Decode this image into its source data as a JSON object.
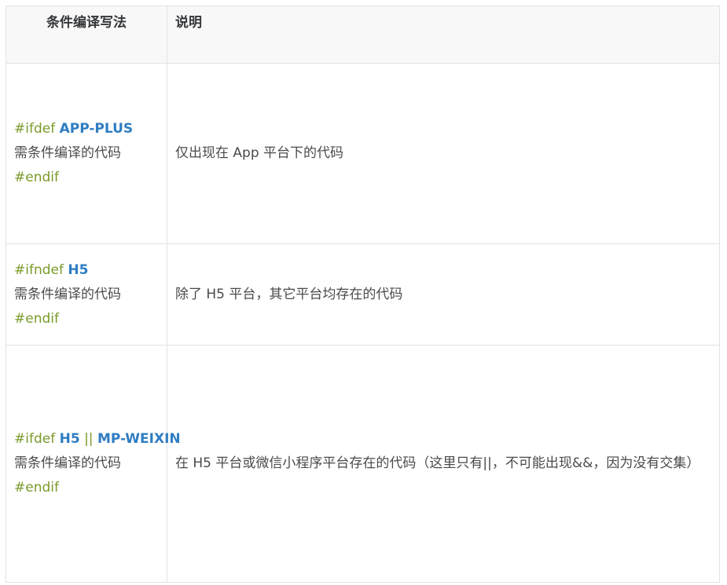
{
  "header": {
    "col1": "条件编译写法",
    "col2": "说明"
  },
  "rows": [
    {
      "directive": "#ifdef",
      "platforms": [
        "APP-PLUS"
      ],
      "body": "需条件编译的代码",
      "end": "#endif",
      "description": "仅出现在 App 平台下的代码"
    },
    {
      "directive": "#ifndef",
      "platforms": [
        "H5"
      ],
      "body": "需条件编译的代码",
      "end": "#endif",
      "description": "除了 H5 平台，其它平台均存在的代码"
    },
    {
      "directive": "#ifdef",
      "platforms": [
        "H5",
        "MP-WEIXIN"
      ],
      "operator": "||",
      "body": "需条件编译的代码",
      "end": "#endif",
      "description": "在 H5 平台或微信小程序平台存在的代码（这里只有||，不可能出现&&，因为没有交集）"
    }
  ],
  "colors": {
    "directive": "#7a9a2a",
    "platform": "#2f7dc2",
    "border": "#dfe2e5",
    "header_bg": "#f8f8f8"
  }
}
